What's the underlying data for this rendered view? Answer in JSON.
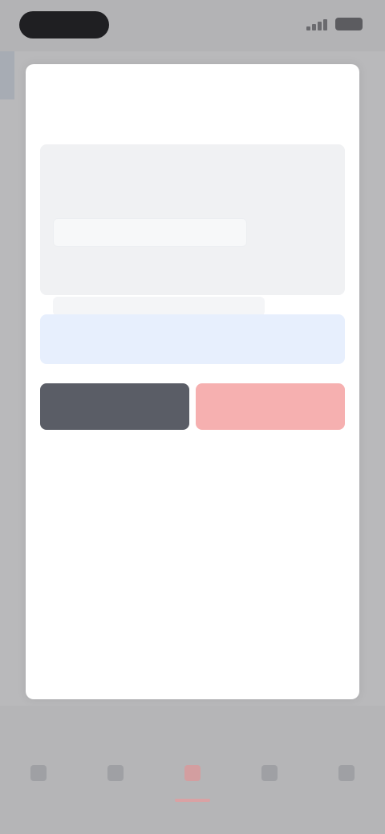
{
  "status_bar": {},
  "modal": {
    "title": "",
    "subtitle": "",
    "section1_label": "",
    "section1_value": "",
    "section1_hint": "",
    "section2_label": "",
    "section2_value": "",
    "section2_hint": "",
    "link_text": "",
    "cancel_label": "",
    "confirm_label": ""
  },
  "bottom_nav": {
    "items": [
      {
        "label": "",
        "icon": "home-icon"
      },
      {
        "label": "",
        "icon": "list-icon"
      },
      {
        "label": "",
        "icon": "center-icon"
      },
      {
        "label": "",
        "icon": "message-icon"
      },
      {
        "label": "",
        "icon": "profile-icon"
      }
    ],
    "active_index": 2
  },
  "colors": {
    "backdrop": "#b9b9bb",
    "sheet": "#ffffff",
    "primary_blue": "#7fa8e6",
    "dark_button": "#5a5d66",
    "danger_button": "#f6b0b0"
  }
}
